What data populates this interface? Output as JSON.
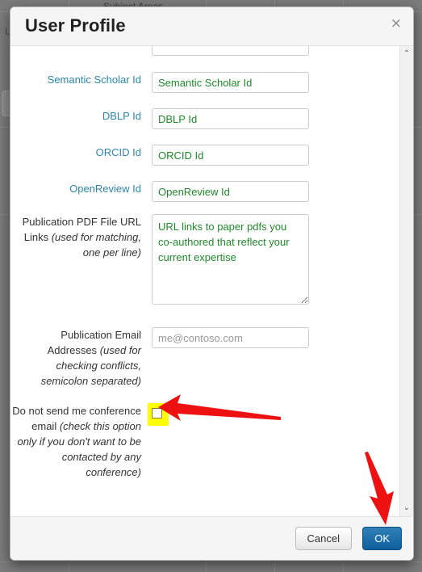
{
  "background": {
    "table_header": "Subject Areas",
    "left_label": "U"
  },
  "modal": {
    "title": "User Profile",
    "close_icon": "close-icon",
    "close_glyph": "×"
  },
  "form": {
    "fields": [
      {
        "label": "Semantic Scholar Id",
        "placeholder": "Semantic Scholar Id",
        "value": "",
        "type": "text",
        "placeholder_color": "#1f8a2a"
      },
      {
        "label": "DBLP Id",
        "placeholder": "DBLP Id",
        "value": "",
        "type": "text",
        "placeholder_color": "#1f8a2a"
      },
      {
        "label": "ORCID Id",
        "placeholder": "ORCID Id",
        "value": "",
        "type": "text",
        "placeholder_color": "#1f8a2a"
      },
      {
        "label": "OpenReview Id",
        "placeholder": "OpenReview Id",
        "value": "",
        "type": "text",
        "placeholder_color": "#1f8a2a"
      }
    ],
    "pdf_links": {
      "label_main": "Publication PDF File URL Links ",
      "label_italic": "(used for matching, one per line)",
      "placeholder": "URL links to paper pdfs you co-authored that reflect your current expertise",
      "value": ""
    },
    "publication_emails": {
      "label_main": "Publication Email Addresses ",
      "label_italic": "(used for checking conflicts, semicolon separated)",
      "placeholder": "me@contoso.com",
      "value": ""
    },
    "no_conference_email": {
      "label_main": "Do not send me conference email ",
      "label_italic": "(check this option only if you don't want to be contacted by any conference)",
      "checked": false,
      "highlight_color": "#ffff00"
    }
  },
  "scrollbar": {
    "up_icon": "chevron-up-icon",
    "up_glyph": "⌃",
    "down_icon": "chevron-down-icon",
    "down_glyph": "⌄"
  },
  "footer": {
    "cancel_label": "Cancel",
    "ok_label": "OK",
    "ok_color": "#1565a0"
  },
  "annotations": {
    "arrow_color": "#ee1111",
    "arrow_checkbox": "points-to-checkbox",
    "arrow_ok": "points-to-ok-button"
  }
}
